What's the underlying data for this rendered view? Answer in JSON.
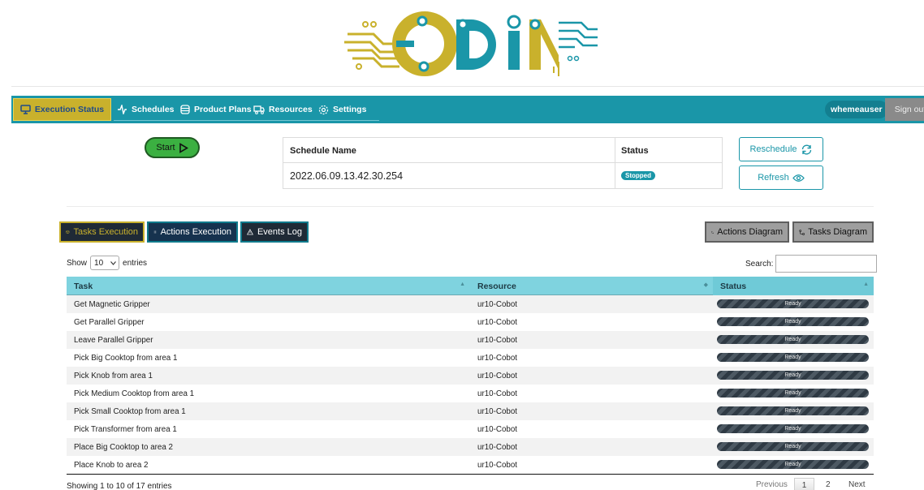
{
  "brand": {
    "logo_text": "ODIN",
    "primary_color": "#1a96a8",
    "accent_color": "#c9b12c"
  },
  "nav": {
    "items": [
      {
        "label": "Execution Status",
        "icon": "monitor-icon",
        "active": true
      },
      {
        "label": "Schedules",
        "icon": "pulse-icon"
      },
      {
        "label": "Product Plans",
        "icon": "database-icon"
      },
      {
        "label": "Resources",
        "icon": "truck-icon"
      },
      {
        "label": "Settings",
        "icon": "gear-icon"
      }
    ],
    "user": "whemeauser",
    "signout_label": "Sign out"
  },
  "schedule": {
    "start_label": "Start",
    "headers": {
      "name": "Schedule Name",
      "status": "Status"
    },
    "name": "2022.06.09.13.42.30.254",
    "status": "Stopped",
    "reschedule_label": "Reschedule",
    "refresh_label": "Refresh"
  },
  "tabs": {
    "tasks": "Tasks Execution",
    "actions": "Actions Execution",
    "events": "Events Log",
    "actions_diagram": "Actions Diagram",
    "tasks_diagram": "Tasks Diagram"
  },
  "table": {
    "show_label": "Show",
    "entries_label": "entries",
    "page_length": "10",
    "search_label": "Search:",
    "search_value": "",
    "columns": [
      "Task",
      "Resource",
      "Status"
    ],
    "rows": [
      {
        "task": "Get Magnetic Gripper",
        "resource": "ur10-Cobot",
        "status": "Ready"
      },
      {
        "task": "Get Parallel Gripper",
        "resource": "ur10-Cobot",
        "status": "Ready"
      },
      {
        "task": "Leave Parallel Gripper",
        "resource": "ur10-Cobot",
        "status": "Ready"
      },
      {
        "task": "Pick Big Cooktop from area 1",
        "resource": "ur10-Cobot",
        "status": "Ready"
      },
      {
        "task": "Pick Knob from area 1",
        "resource": "ur10-Cobot",
        "status": "Ready"
      },
      {
        "task": "Pick Medium Cooktop from area 1",
        "resource": "ur10-Cobot",
        "status": "Ready"
      },
      {
        "task": "Pick Small Cooktop from area 1",
        "resource": "ur10-Cobot",
        "status": "Ready"
      },
      {
        "task": "Pick Transformer from area 1",
        "resource": "ur10-Cobot",
        "status": "Ready"
      },
      {
        "task": "Place Big Cooktop to area 2",
        "resource": "ur10-Cobot",
        "status": "Ready"
      },
      {
        "task": "Place Knob to area 2",
        "resource": "ur10-Cobot",
        "status": "Ready"
      }
    ],
    "info": "Showing 1 to 10 of 17 entries",
    "pagination": {
      "previous": "Previous",
      "pages": [
        "1",
        "2"
      ],
      "next": "Next"
    }
  }
}
